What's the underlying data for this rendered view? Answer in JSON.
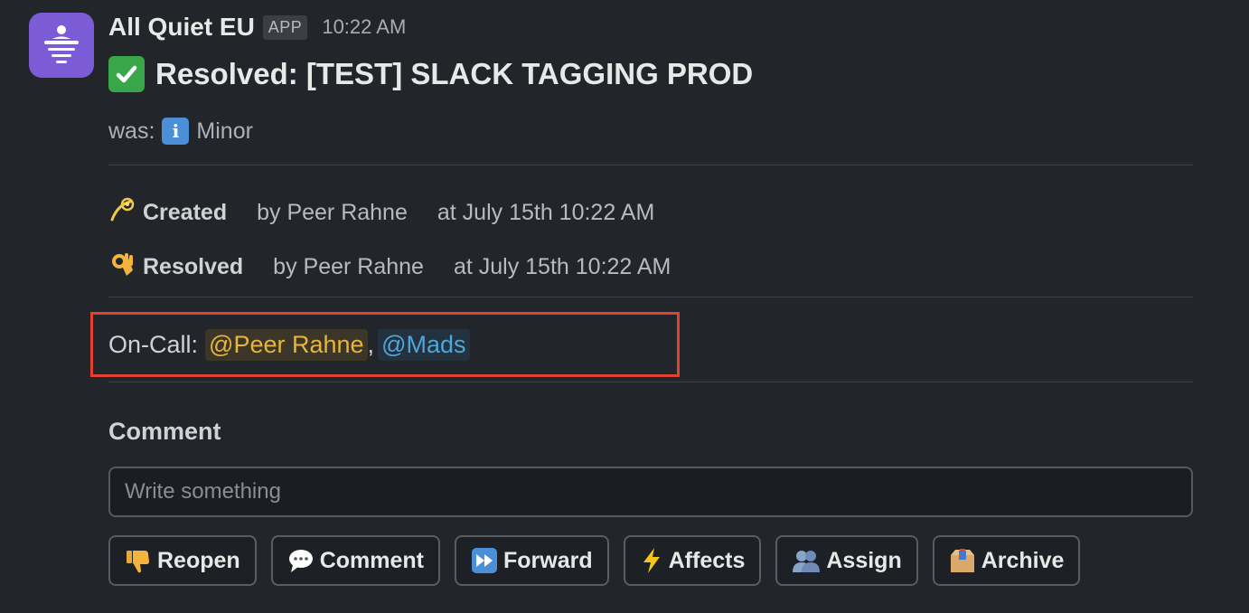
{
  "message": {
    "app_name": "All Quiet EU",
    "app_badge": "APP",
    "timestamp": "10:22 AM",
    "title": "Resolved: [TEST] SLACK TAGGING PROD",
    "was_label": "was:",
    "was_severity": "Minor",
    "events": [
      {
        "icon": "dizzy-icon",
        "label": "Created",
        "by": "by Peer Rahne",
        "at": "at July 15th 10:22 AM"
      },
      {
        "icon": "ok-hand-icon",
        "label": "Resolved",
        "by": "by Peer Rahne",
        "at": "at July 15th 10:22 AM"
      }
    ],
    "oncall": {
      "label": "On-Call:",
      "mentions": [
        "@Peer Rahne",
        "@Mads"
      ],
      "separator": ","
    },
    "comment": {
      "heading": "Comment",
      "placeholder": "Write something"
    },
    "actions": [
      {
        "label": "Reopen",
        "icon": "thumbs-down-icon"
      },
      {
        "label": "Comment",
        "icon": "speech-bubble-icon"
      },
      {
        "label": "Forward",
        "icon": "fast-forward-icon"
      },
      {
        "label": "Affects",
        "icon": "lightning-icon"
      },
      {
        "label": "Assign",
        "icon": "people-icon"
      },
      {
        "label": "Archive",
        "icon": "box-icon"
      }
    ]
  },
  "colors": {
    "background": "#222529",
    "avatar": "#7b5bd6",
    "highlight_border": "#e5412f",
    "mention_user": "#e6b53a",
    "mention_other": "#4ea7dc"
  }
}
